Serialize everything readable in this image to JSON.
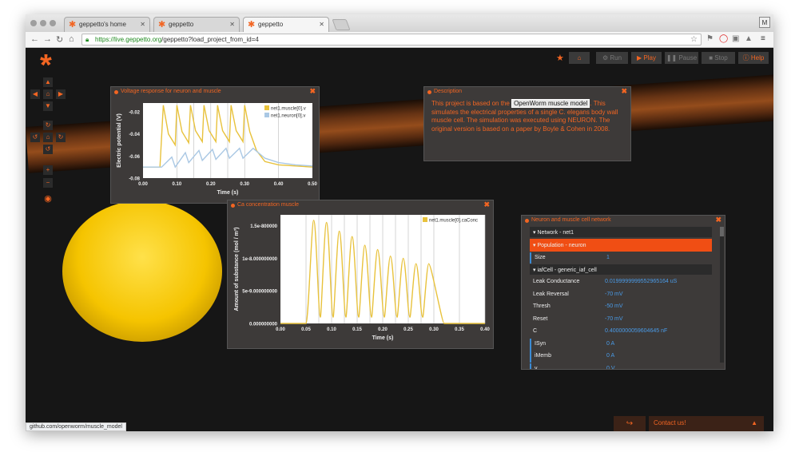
{
  "browser": {
    "tabs": [
      {
        "label": "geppetto's home"
      },
      {
        "label": "geppetto"
      },
      {
        "label": "geppetto"
      }
    ],
    "profile_initial": "M",
    "url_host": "https://live.geppetto.org",
    "url_path": "/geppetto?load_project_from_id=4",
    "status_link": "github.com/openworm/muscle_model"
  },
  "toolbar": {
    "run": "Run",
    "play": "Play",
    "pause": "Pause",
    "stop": "Stop",
    "help": "Help"
  },
  "voltage_panel": {
    "title": "Voltage response for neuron and muscle",
    "chart_data": {
      "type": "line",
      "xlabel": "Time (s)",
      "ylabel": "Electric potential (V)",
      "xlim": [
        0,
        0.5
      ],
      "ylim": [
        -0.08,
        -0.012
      ],
      "x_ticks": [
        "0.00",
        "0.10",
        "0.20",
        "0.30",
        "0.40",
        "0.50"
      ],
      "y_ticks": [
        "-0.02",
        "-0.04",
        "-0.06",
        "-0.08"
      ],
      "legend": [
        "net1.muscle[0].v",
        "net1.neuron[0].v"
      ],
      "series": [
        {
          "name": "net1.muscle[0].v",
          "color": "#e8c23c",
          "x": [
            0.0,
            0.05,
            0.06,
            0.075,
            0.095,
            0.1,
            0.115,
            0.135,
            0.14,
            0.155,
            0.175,
            0.18,
            0.195,
            0.215,
            0.22,
            0.235,
            0.255,
            0.26,
            0.275,
            0.295,
            0.3,
            0.315,
            0.335,
            0.36,
            0.4,
            0.45,
            0.5
          ],
          "y": [
            -0.07,
            -0.07,
            -0.014,
            -0.04,
            -0.05,
            -0.014,
            -0.038,
            -0.048,
            -0.014,
            -0.037,
            -0.047,
            -0.014,
            -0.037,
            -0.047,
            -0.014,
            -0.037,
            -0.047,
            -0.014,
            -0.037,
            -0.047,
            -0.014,
            -0.038,
            -0.055,
            -0.065,
            -0.068,
            -0.069,
            -0.07
          ]
        },
        {
          "name": "net1.neuron[0].v",
          "color": "#aac8e4",
          "x": [
            0.0,
            0.05,
            0.055,
            0.085,
            0.095,
            0.125,
            0.135,
            0.165,
            0.175,
            0.205,
            0.215,
            0.245,
            0.255,
            0.285,
            0.295,
            0.325,
            0.36,
            0.4,
            0.45,
            0.5
          ],
          "y": [
            -0.07,
            -0.07,
            -0.07,
            -0.061,
            -0.07,
            -0.057,
            -0.066,
            -0.055,
            -0.064,
            -0.054,
            -0.063,
            -0.053,
            -0.062,
            -0.053,
            -0.062,
            -0.053,
            -0.062,
            -0.066,
            -0.068,
            -0.069
          ]
        }
      ],
      "stim_lines_x": [
        0.1,
        0.15,
        0.2,
        0.25,
        0.3,
        0.4
      ]
    }
  },
  "description_panel": {
    "title": "Description",
    "text_before": "This project is based on the ",
    "link_text": "OpenWorm muscle model",
    "text_after": ". This simulates the electrical properties of a single C. elegans body wall muscle cell. The simulation was executed using NEURON. The original version is based on a paper by Boyle & Cohen in 2008."
  },
  "ca_panel": {
    "title": "Ca concentration muscle",
    "chart_data": {
      "type": "line",
      "xlabel": "Time (s)",
      "ylabel": "Amount of substance (mol / m³)",
      "xlim": [
        0,
        0.4
      ],
      "ylim": [
        0,
        1.0
      ],
      "x_ticks": [
        "0.00",
        "0.05",
        "0.10",
        "0.15",
        "0.20",
        "0.25",
        "0.30",
        "0.35",
        "0.40"
      ],
      "y_ticks": [
        "1.5e-800000",
        "1e-8.000000000",
        "5e-9.000000000",
        "0.000000000"
      ],
      "legend": [
        "net1.muscle[0].caConc"
      ],
      "series": [
        {
          "name": "net1.muscle[0].caConc",
          "color": "#e8c23c",
          "peaks_x": [
            0.065,
            0.09,
            0.115,
            0.14,
            0.165,
            0.19,
            0.215,
            0.24,
            0.265,
            0.29
          ],
          "peaks_y": [
            0.95,
            0.93,
            0.85,
            0.8,
            0.72,
            0.68,
            0.62,
            0.6,
            0.55,
            0.55
          ]
        }
      ],
      "stim_lines_x": [
        0.05,
        0.075,
        0.1,
        0.125,
        0.15,
        0.175,
        0.2,
        0.225,
        0.25,
        0.275,
        0.3,
        0.35,
        0.4
      ]
    }
  },
  "network_panel": {
    "title": "Neuron and muscle cell network",
    "network": "Network - net1",
    "population": "Population - neuron",
    "size_label": "Size",
    "size_value": "1",
    "cell": "iafCell - generic_iaf_cell",
    "params": [
      {
        "label": "Leak Conductance",
        "value": "0.0199999999552965164 uS"
      },
      {
        "label": "Leak Reversal",
        "value": "-70 mV"
      },
      {
        "label": "Thresh",
        "value": "-50 mV"
      },
      {
        "label": "Reset",
        "value": "-70 mV"
      },
      {
        "label": "C",
        "value": "0.4000000059604645 nF"
      },
      {
        "label": "ISyn",
        "value": "0 A"
      },
      {
        "label": "iMemb",
        "value": "0 A"
      },
      {
        "label": "v",
        "value": "0 V"
      }
    ]
  },
  "footer": {
    "contact": "Contact us!",
    "contact_icon": "chevron-up-icon",
    "share_icon": "share-icon"
  }
}
